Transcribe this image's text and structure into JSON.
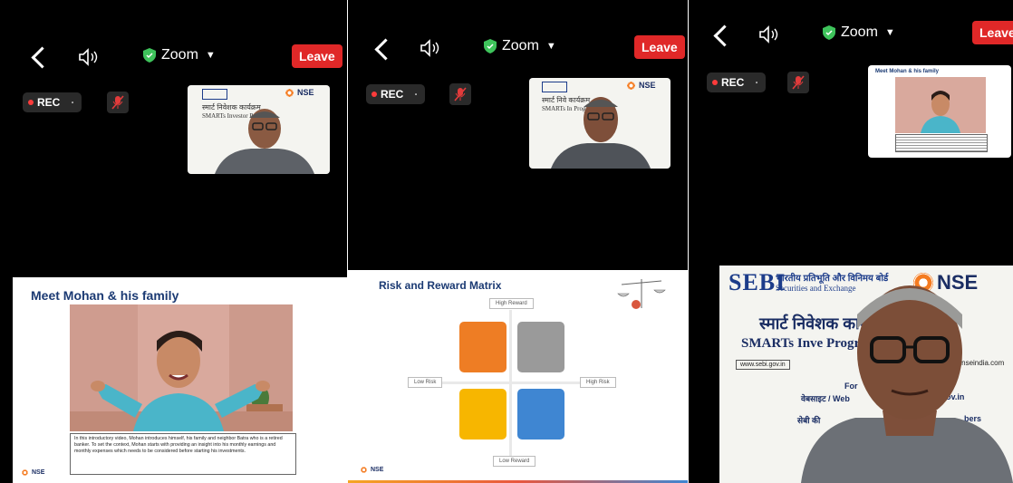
{
  "zoom": {
    "title": "Zoom",
    "leave_label": "Leave",
    "rec_label": "REC"
  },
  "panels": [
    {
      "slide_title": "Meet Mohan & his family",
      "caption": "In this introductory video, Mohan introduces himself, his family and neighbor Batra who is a retired banker. To set the context, Mohan starts with providing an insight into his monthly earnings and monthly expenses which needs to be considered before starting his investments.",
      "footer_logo": "NSE",
      "tile": {
        "nse": "NSE",
        "hindi": "स्मार्ट निवेशक कार्यक्रम",
        "english": "SMARTs Investor Program"
      }
    },
    {
      "slide_title": "Risk and Reward Matrix",
      "high_reward": "High Reward",
      "low_reward": "Low Reward",
      "low_risk": "Low Risk",
      "high_risk": "High Risk",
      "footer_logo": "NSE",
      "tile": {
        "nse": "NSE",
        "hindi": "स्मार्ट निवे कार्यक्रम",
        "english": "SMARTs In Program"
      }
    },
    {
      "tile_title": "Meet Mohan & his family",
      "sebi": "SEBI",
      "sebi_hindi": "भारतीय प्रतिभूति और विनिमय बोर्ड",
      "sebi_english": "Securities and Exchange",
      "nse": "NSE",
      "program_hindi": "स्मार्ट निवेशक कार्यक्रम",
      "program_english": "SMARTs Inve Program",
      "url_left": "www.sebi.gov.in",
      "url_right": "www.nseindia.com",
      "for_text": "For",
      "website_text": "वेबसाइट / Web",
      "gov_text": "bi.gov.in",
      "line_text": "सेबी की",
      "members_text": "bers"
    }
  ],
  "colors": {
    "leave": "#e02828",
    "shield": "#3ec35b",
    "q_orange": "#ee7d24",
    "q_grey": "#9a9a9a",
    "q_yellow": "#f7b600",
    "q_blue": "#3f86d2"
  }
}
